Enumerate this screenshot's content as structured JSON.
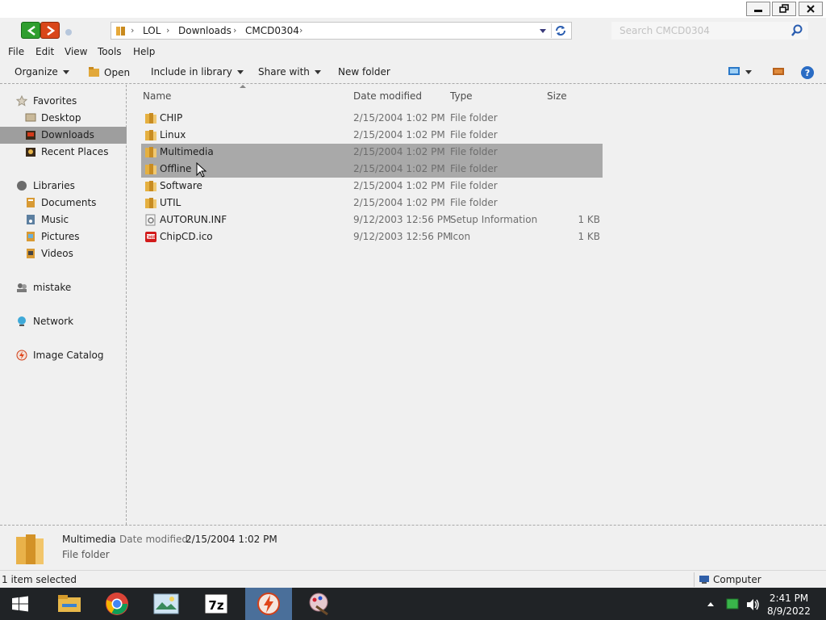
{
  "window": {
    "controls": {
      "minimize": "minimize",
      "maximize": "restore",
      "close": "close"
    }
  },
  "address": {
    "crumbs": [
      "LOL",
      "Downloads",
      "CMCD0304"
    ],
    "search_placeholder": "Search CMCD0304"
  },
  "menu": [
    "File",
    "Edit",
    "View",
    "Tools",
    "Help"
  ],
  "toolbar": {
    "organize": "Organize",
    "open": "Open",
    "include": "Include in library",
    "share": "Share with",
    "new_folder": "New folder"
  },
  "nav": {
    "favorites": "Favorites",
    "desktop": "Desktop",
    "downloads": "Downloads",
    "recent": "Recent Places",
    "libraries": "Libraries",
    "documents": "Documents",
    "music": "Music",
    "pictures": "Pictures",
    "videos": "Videos",
    "user": "mistake",
    "network": "Network",
    "catalog": "Image Catalog"
  },
  "columns": {
    "name": "Name",
    "date": "Date modified",
    "type": "Type",
    "size": "Size"
  },
  "files": [
    {
      "name": "CHIP",
      "date": "2/15/2004 1:02 PM",
      "type": "File folder",
      "size": "",
      "icon": "folder-icon",
      "selected": false
    },
    {
      "name": "Linux",
      "date": "2/15/2004 1:02 PM",
      "type": "File folder",
      "size": "",
      "icon": "folder-icon",
      "selected": false
    },
    {
      "name": "Multimedia",
      "date": "2/15/2004 1:02 PM",
      "type": "File folder",
      "size": "",
      "icon": "folder-icon",
      "selected": true
    },
    {
      "name": "Offline",
      "date": "2/15/2004 1:02 PM",
      "type": "File folder",
      "size": "",
      "icon": "folder-icon",
      "selected": true
    },
    {
      "name": "Software",
      "date": "2/15/2004 1:02 PM",
      "type": "File folder",
      "size": "",
      "icon": "folder-icon",
      "selected": false
    },
    {
      "name": "UTIL",
      "date": "2/15/2004 1:02 PM",
      "type": "File folder",
      "size": "",
      "icon": "folder-icon",
      "selected": false
    },
    {
      "name": "AUTORUN.INF",
      "date": "9/12/2003 12:56 PM",
      "type": "Setup Information",
      "size": "1 KB",
      "icon": "setup-file-icon",
      "selected": false
    },
    {
      "name": "ChipCD.ico",
      "date": "9/12/2003 12:56 PM",
      "type": "Icon",
      "size": "1 KB",
      "icon": "chip-icon-file",
      "selected": false
    }
  ],
  "details": {
    "name": "Multimedia",
    "date_label": "Date modified:",
    "date_value": "2/15/2004 1:02 PM",
    "type": "File folder"
  },
  "status": {
    "selection": "1 item selected",
    "location": "Computer"
  },
  "taskbar": {
    "apps": [
      "file-explorer",
      "chrome",
      "image-viewer",
      "7-zip",
      "flash-app",
      "paint-app"
    ],
    "clock_time": "2:41 PM",
    "clock_date": "8/9/2022"
  },
  "colors": {
    "selection": "#a9a9a9",
    "nav_selected": "#9e9e9e",
    "taskbar": "#202326",
    "taskbar_active": "#4a6f9a"
  }
}
